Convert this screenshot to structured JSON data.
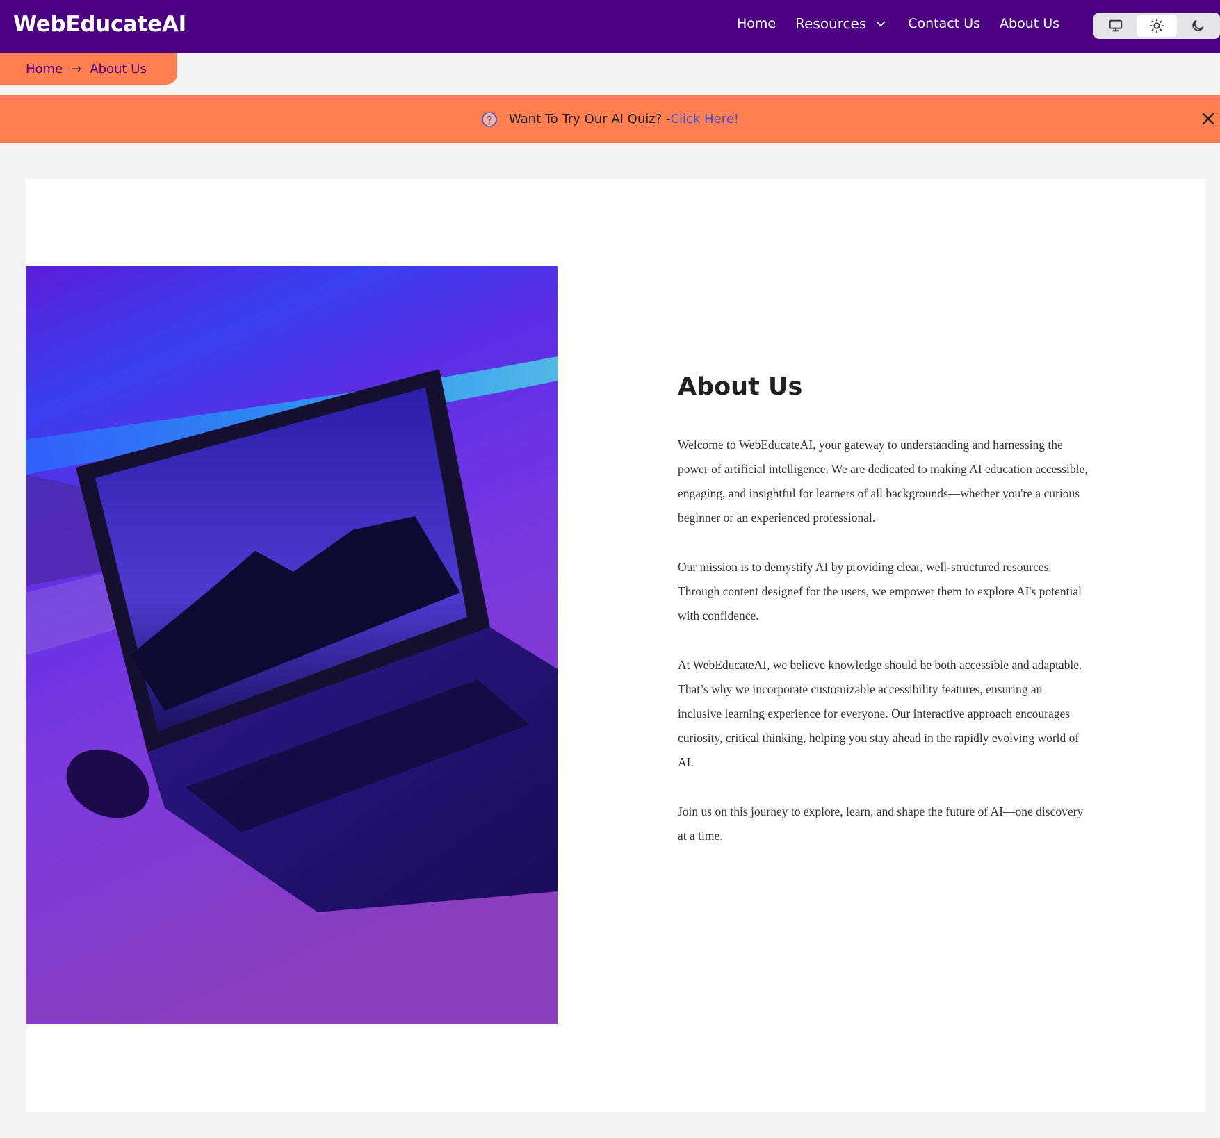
{
  "header": {
    "brand": "WebEducateAI",
    "nav": {
      "home": "Home",
      "resources": "Resources",
      "contact": "Contact Us",
      "about": "About Us"
    },
    "theme_modes": [
      "system-icon",
      "sun-icon",
      "moon-icon"
    ],
    "active_theme": "light",
    "bg_color": "#4b0082"
  },
  "breadcrumb": {
    "home": "Home",
    "separator": "→",
    "current": "About Us"
  },
  "banner": {
    "text": "Want To Try Our AI Quiz? - ",
    "link": "Click Here!",
    "bg_color": "#ff7f50"
  },
  "about": {
    "title": "About Us",
    "paragraphs": [
      "Welcome to WebEducateAI, your gateway to understanding and harnessing the power of artificial intelligence. We are dedicated to making AI education accessible, engaging, and insightful for learners of all backgrounds—whether you're a curious beginner or an experienced professional.",
      "Our mission is to demystify AI by providing clear, well-structured resources. Through content designef for the users, we empower them to explore AI's potential with confidence.",
      "At WebEducateAI, we believe knowledge should be both accessible and adaptable. That’s why we incorporate customizable accessibility features, ensuring an inclusive learning experience for everyone. Our interactive approach encourages curiosity, critical thinking, helping you stay ahead in the rapidly evolving world of AI.",
      "Join us on this journey to explore, learn, and shape the future of AI—one discovery at a time."
    ]
  }
}
